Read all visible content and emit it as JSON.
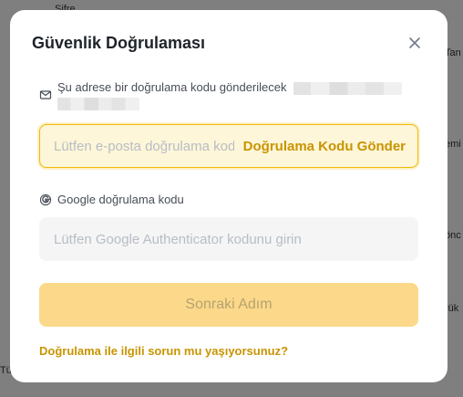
{
  "modal": {
    "title": "Güvenlik Doğrulaması",
    "email_notice": "Şu adrese bir doğrulama kodu gönderilecek",
    "email_code_placeholder": "Lütfen e-posta doğrulama kodunu girin",
    "send_code_label": "Doğrulama Kodu Gönder",
    "google_label": "Google doğrulama kodu",
    "google_placeholder": "Lütfen Google Authenticator kodunu girin",
    "next_label": "Sonraki Adım",
    "help_link": "Doğrulama ile ilgili sorun mu yaşıyorsunuz?"
  },
  "colors": {
    "accent": "#f0b90b",
    "link": "#c99400",
    "disabled_button": "#fcd98a"
  },
  "icons": {
    "close": "close-icon",
    "mail": "mail-icon",
    "google": "google-icon"
  }
}
